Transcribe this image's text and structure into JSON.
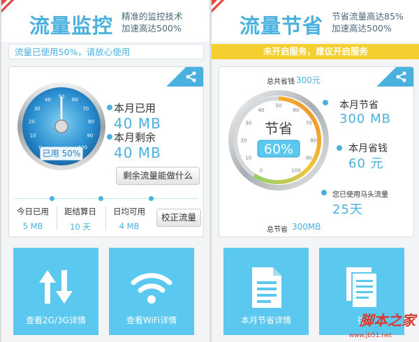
{
  "left": {
    "title": "流量监控",
    "subtitle_line1": "精准的监控技术",
    "subtitle_line2": "加速高达500%",
    "notice": "流量已使用50%，请放心使用",
    "gauge": {
      "used_label": "已用 50%",
      "used_fraction": 0.5,
      "ticks": [
        "0",
        "10",
        "20",
        "30",
        "40",
        "50",
        "60",
        "70",
        "80",
        "90",
        "100"
      ]
    },
    "month_used_label": "本月已用",
    "month_used_value": "40 MB",
    "month_left_label": "本月剩余",
    "month_left_value": "40 MB",
    "what_button": "剩余流量能做什么",
    "stats": [
      {
        "label": "今日已用",
        "value": "5 MB"
      },
      {
        "label": "距结算日",
        "value": "10 天"
      },
      {
        "label": "日均可用",
        "value": "4 MB"
      }
    ],
    "calibrate_button": "校正流量",
    "tiles": [
      {
        "label": "查看2G/3G详情",
        "icon": "up-down-arrows-icon"
      },
      {
        "label": "查看WiFi详情",
        "icon": "wifi-icon"
      }
    ]
  },
  "right": {
    "title": "流量节省",
    "subtitle_line1": "节省流量高达85%",
    "subtitle_line2": "加速高达500%",
    "notice": "未开启服务，建议开启服务",
    "gauge": {
      "center_label": "节省",
      "percent_label": "60%",
      "ticks": [
        "0",
        "10",
        "20",
        "30",
        "40",
        "50",
        "60",
        "70",
        "80",
        "90",
        "100"
      ]
    },
    "total_saved_money_label": "总共省钱",
    "total_saved_money_value": "300元",
    "month_saved_label": "本月节省",
    "month_saved_value": "300 MB",
    "month_money_label": "本月省钱",
    "month_money_value": "60 元",
    "mtour_label": "您已使用马头流量",
    "mtour_value": "25天",
    "total_saved_label": "总节省",
    "total_saved_value": "300MB",
    "tiles": [
      {
        "label": "本月节省详情",
        "icon": "document-icon"
      },
      {
        "label": "往",
        "icon": "documents-icon"
      }
    ]
  },
  "watermark": {
    "text": "脚本之家",
    "url": "www.jb51.net"
  },
  "colors": {
    "accent": "#4ab1de",
    "tile": "#5ac8ef",
    "notice_yellow": "#f4cf2f",
    "ribbon_red": "#e4463f"
  }
}
